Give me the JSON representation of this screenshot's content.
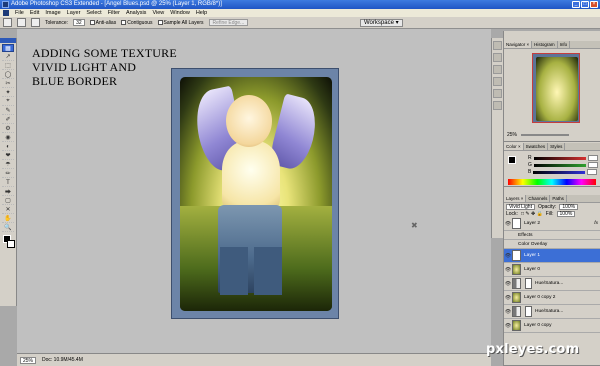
{
  "window": {
    "title": "Adobe Photoshop CS3 Extended - [Angel Blues.psd @ 25% (Layer 1, RGB/8*)]"
  },
  "menu": [
    "File",
    "Edit",
    "Image",
    "Layer",
    "Select",
    "Filter",
    "Analysis",
    "View",
    "Window",
    "Help"
  ],
  "options": {
    "tolerance_label": "Tolerance:",
    "tolerance_value": "32",
    "anti_alias": "Anti-alias",
    "contiguous": "Contiguous",
    "sample_all": "Sample All Layers",
    "refine_edge": "Refine Edge...",
    "workspace": "Workspace ▾"
  },
  "tools": [
    "▦",
    "↗",
    "⬚",
    "◯",
    "✂",
    "✦",
    "⌖",
    "✎",
    "✐",
    "⚙",
    "◉",
    "◐",
    "❤",
    "☂",
    "✏",
    "T",
    "⮕",
    "▢",
    "✕",
    "✋",
    "🔍"
  ],
  "canvas": {
    "heading": [
      "ADDING SOME TEXTURE",
      "VIVID LIGHT AND",
      "BLUE BORDER"
    ],
    "crosshair": "✖"
  },
  "status": {
    "zoom": "25%",
    "doc": "Doc: 10.9M/45.4M"
  },
  "navigator": {
    "tabs": [
      "Navigator ×",
      "Histogram",
      "Info"
    ],
    "zoom": "25%"
  },
  "color_panel": {
    "tabs": [
      "Color ×",
      "Swatches",
      "Styles"
    ],
    "channels": [
      {
        "name": "R",
        "color": "#d43030"
      },
      {
        "name": "G",
        "color": "#30a030"
      },
      {
        "name": "B",
        "color": "#3030d4"
      }
    ]
  },
  "layers_panel": {
    "tabs": [
      "Layers ×",
      "Channels",
      "Paths"
    ],
    "blend_mode": "Vivid Light",
    "opacity_label": "Opacity:",
    "opacity": "100%",
    "lock_label": "Lock:",
    "fill_label": "Fill:",
    "fill": "100%",
    "layers": [
      {
        "name": "Layer 2",
        "thumb": "plain",
        "fx": "fx"
      },
      {
        "name": "Effects",
        "sub": true
      },
      {
        "name": "Color Overlay",
        "sub": true
      },
      {
        "name": "Layer 1",
        "thumb": "plain",
        "selected": true
      },
      {
        "name": "Layer 0",
        "thumb": "img"
      },
      {
        "name": "Hue/Satura...",
        "thumb": "adj"
      },
      {
        "name": "Layer 0 copy 2",
        "thumb": "img"
      },
      {
        "name": "Hue/Satura...",
        "thumb": "adj"
      },
      {
        "name": "Layer 0 copy",
        "thumb": "img"
      }
    ]
  },
  "watermark": "pxleyes.com"
}
